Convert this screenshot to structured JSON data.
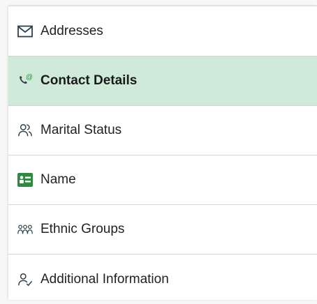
{
  "nav": {
    "items": [
      {
        "label": "Addresses",
        "icon": "envelope-icon",
        "selected": false
      },
      {
        "label": "Contact Details",
        "icon": "phone-at-icon",
        "selected": true
      },
      {
        "label": "Marital Status",
        "icon": "people-icon",
        "selected": false
      },
      {
        "label": "Name",
        "icon": "name-card-icon",
        "selected": false
      },
      {
        "label": "Ethnic Groups",
        "icon": "group-icon",
        "selected": false
      },
      {
        "label": "Additional Information",
        "icon": "person-check-icon",
        "selected": false
      }
    ]
  },
  "colors": {
    "selected_background": "#cfead9",
    "accent_green": "#2e8b3e",
    "icon_dark": "#2b3f4c",
    "divider": "#d4d4d4"
  }
}
